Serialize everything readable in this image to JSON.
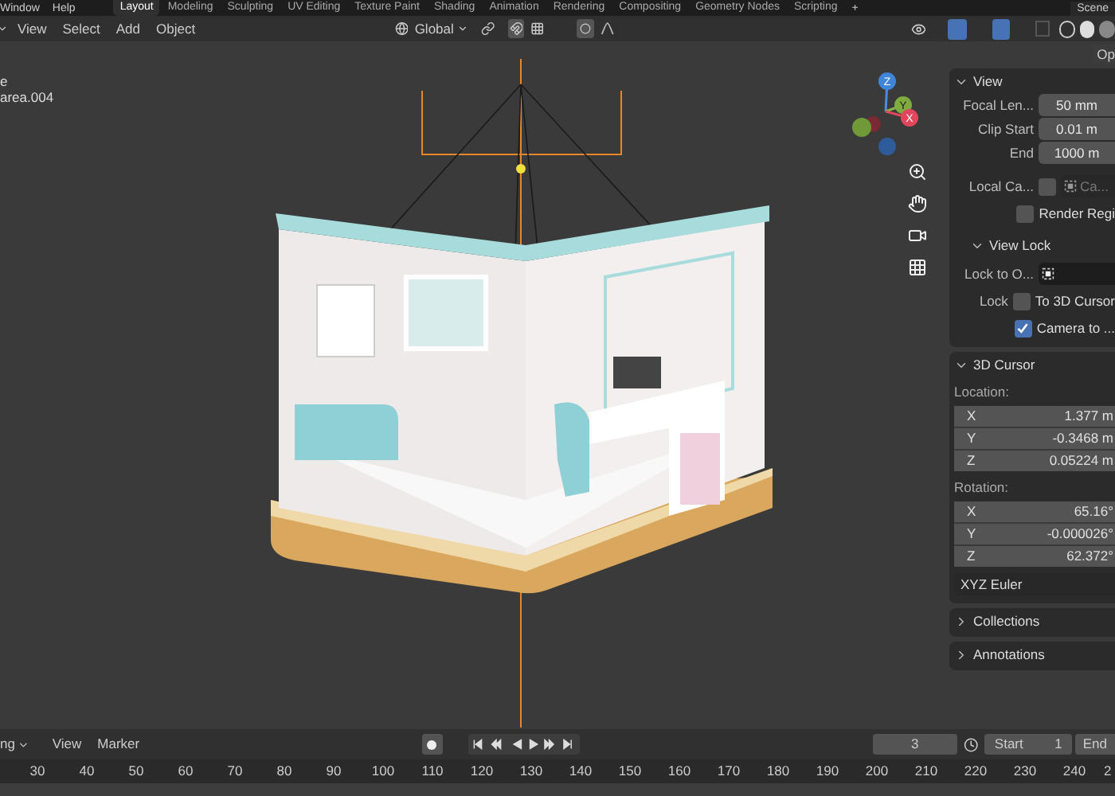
{
  "top_bar": {
    "menus": [
      "Window",
      "Help"
    ],
    "workspaces": [
      {
        "label": "Layout",
        "selected": true
      },
      {
        "label": "Modeling",
        "selected": false
      },
      {
        "label": "Sculpting",
        "selected": false
      },
      {
        "label": "UV Editing",
        "selected": false
      },
      {
        "label": "Texture Paint",
        "selected": false
      },
      {
        "label": "Shading",
        "selected": false
      },
      {
        "label": "Animation",
        "selected": false
      },
      {
        "label": "Rendering",
        "selected": false
      },
      {
        "label": "Compositing",
        "selected": false
      },
      {
        "label": "Geometry Nodes",
        "selected": false
      },
      {
        "label": "Scripting",
        "selected": false
      }
    ],
    "add_tab": "+",
    "scene": "Scene"
  },
  "viewport_header": {
    "menus": [
      "View",
      "Select",
      "Add",
      "Object"
    ],
    "orientation": "Global",
    "options": "Op"
  },
  "viewport": {
    "overlay_lines": [
      "e",
      "area.004"
    ],
    "gizmo_axes": [
      "Z",
      "Y",
      "X"
    ]
  },
  "sidebar": {
    "sections": [
      {
        "title": "View",
        "expanded": true,
        "rows": [
          {
            "kind": "field",
            "label": "Focal Len...",
            "value": "50 mm"
          },
          {
            "kind": "field",
            "label": "Clip Start",
            "value": "0.01 m"
          },
          {
            "kind": "field",
            "label": "End",
            "value": "1000 m"
          },
          {
            "kind": "checkbox_object",
            "label": "Local Ca...",
            "checked": false,
            "placeholder": "Ca..."
          },
          {
            "kind": "checkbox",
            "label": "Render Regi",
            "checked": false
          },
          {
            "kind": "subsection",
            "title": "View Lock",
            "expanded": true
          },
          {
            "kind": "object",
            "label": "Lock to O..."
          },
          {
            "kind": "checkbox",
            "prefix": "Lock",
            "label": "To 3D Cursor",
            "checked": false
          },
          {
            "kind": "checkbox",
            "label": "Camera to ...",
            "checked": true
          }
        ]
      },
      {
        "title": "3D Cursor",
        "expanded": true,
        "rows": [
          {
            "kind": "heading",
            "label": "Location:"
          },
          {
            "kind": "vector",
            "items": [
              {
                "axis": "X",
                "value": "1.377 m"
              },
              {
                "axis": "Y",
                "value": "-0.3468 m"
              },
              {
                "axis": "Z",
                "value": "0.05224 m"
              }
            ]
          },
          {
            "kind": "heading",
            "label": "Rotation:"
          },
          {
            "kind": "vector",
            "items": [
              {
                "axis": "X",
                "value": "65.16°"
              },
              {
                "axis": "Y",
                "value": "-0.000026°"
              },
              {
                "axis": "Z",
                "value": "62.372°"
              }
            ]
          },
          {
            "kind": "dropdown",
            "value": "XYZ Euler"
          }
        ]
      },
      {
        "title": "Collections",
        "expanded": false
      },
      {
        "title": "Annotations",
        "expanded": false
      }
    ]
  },
  "timeline": {
    "menus": [
      "ng",
      "View",
      "Marker"
    ],
    "current_frame": "3",
    "start_label": "Start",
    "start_value": "1",
    "end_label": "End",
    "ruler": [
      "30",
      "40",
      "50",
      "60",
      "70",
      "80",
      "90",
      "100",
      "110",
      "120",
      "130",
      "140",
      "150",
      "160",
      "170",
      "180",
      "190",
      "200",
      "210",
      "220",
      "230",
      "240",
      "2"
    ]
  }
}
